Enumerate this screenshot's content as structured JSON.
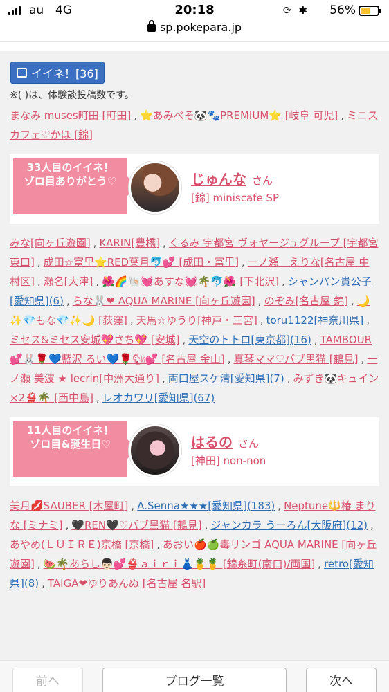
{
  "statusbar": {
    "carrier": "au",
    "network": "4G",
    "time": "20:18",
    "battery": "56%",
    "battery_level": 0.56
  },
  "urlbar": {
    "host": "sp.pokepara.jp"
  },
  "like": {
    "label": "イイネ！[36]",
    "note": "※( )は、体験談投稿数です。"
  },
  "intro_names": [
    {
      "t": "まなみ muses町田 [町田]"
    },
    {
      "t": "⭐あみぺそ🐼🐾PREMIUM⭐ [岐阜 可児]"
    },
    {
      "t": "ミニスカフェ♡かほ [錦]"
    }
  ],
  "blocks": [
    {
      "ribbon": "33人目のイイネ！\nゾロ目ありがとう♡",
      "name": "じゅんな",
      "san": "さん",
      "shop": "[錦] miniscafe SP",
      "names": [
        {
          "t": "みな[向ヶ丘遊園]"
        },
        {
          "t": "KARIN[豊橋]"
        },
        {
          "t": "くるみ 宇都宮 ヴォヤージュグループ [宇都宮東口]"
        },
        {
          "t": "成田☆富里⭐RED葉月🐬💕 [成田・富里]"
        },
        {
          "t": "一ノ瀬　えりな[名古屋 中村区]"
        },
        {
          "t": "瀬名[大津]"
        },
        {
          "t": "🌺🌈🐚💓あすな💓🌴🐬🌺 [下北沢]"
        },
        {
          "t": "シャンパン貴公子[愛知県](6)",
          "b": true
        },
        {
          "t": "らな🐰❤ AQUA MARINE [向ヶ丘遊園]"
        },
        {
          "t": "のぞみ[名古屋 錦]"
        },
        {
          "t": "🌙✨💎もな💎✨🌙 [荻窪]"
        },
        {
          "t": "天馬☆ゆうり[神戸・三宮]"
        },
        {
          "t": "toru1122[神奈川県]",
          "b": true
        },
        {
          "t": "ミセス&ミセス安城💖さち💖 [安城]"
        },
        {
          "t": "天空のトトロ[東京都](16)",
          "b": true
        },
        {
          "t": "TAMBOUR💕🐰🌹💙藍沢 るい💙🌹🐿💕 [名古屋 金山]"
        },
        {
          "t": "真琴ママ♡パブ黒猫 [鶴見]"
        },
        {
          "t": "一ノ瀬 美波 ★ lecrin[中洲大通り]"
        },
        {
          "t": "両口屋スケ清[愛知県](7)",
          "b": true
        },
        {
          "t": "みずき🐼キュイン×2👙🌴 [西中島]"
        },
        {
          "t": "レオカワリ[愛知県](67)",
          "b": true
        }
      ]
    },
    {
      "ribbon": "11人目のイイネ！\nゾロ目&誕生日♡",
      "name": "はるの",
      "san": "さん",
      "shop": "[神田] non-non",
      "names": [
        {
          "t": "美月💋SAUBER [木屋町]"
        },
        {
          "t": "A.Senna★★★[愛知県](183)",
          "b": true
        },
        {
          "t": "Neptune🔱椿 まりな [ミナミ]"
        },
        {
          "t": "🖤REN🖤♡パブ黒猫 [鶴見]"
        },
        {
          "t": "ジャンカラ うーろん[大阪府](12)",
          "b": true
        },
        {
          "t": "あやめ(ＬＵＩＲＥ)京橋 [京橋]"
        },
        {
          "t": "あおい🍎🍏毒リンゴ AQUA MARINE [向ヶ丘遊園]"
        },
        {
          "t": "🍉🌴あらし👦🏻💕👙ａｉｒｉ👗🍍🍍 [錦糸町(南口)/両国]"
        },
        {
          "t": "retro[愛知県](8)",
          "b": true
        },
        {
          "t": "TAIGA❤ゆりあんぬ [名古屋 名駅]"
        }
      ]
    }
  ],
  "footer": {
    "prev": "前へ",
    "list": "ブログ一覧",
    "next": "次へ"
  }
}
